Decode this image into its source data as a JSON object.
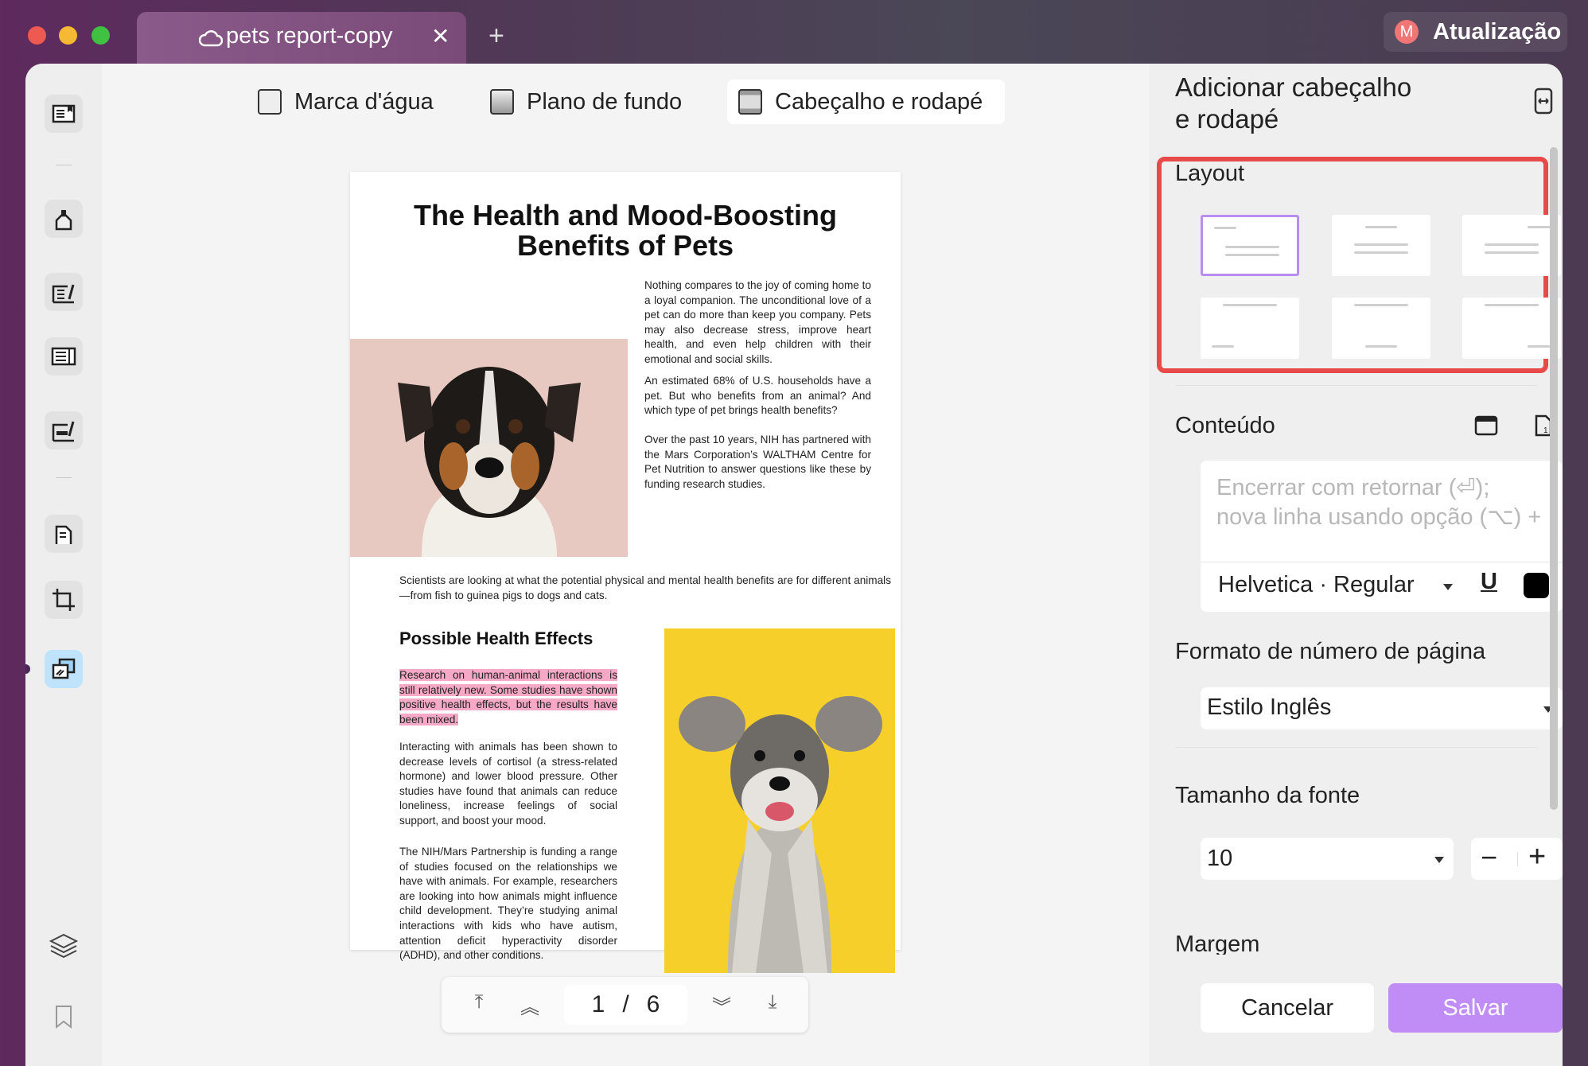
{
  "titlebar": {
    "tab_title": "pets report-copy",
    "update_label": "Atualização",
    "avatar_letter": "M"
  },
  "toolbar": {
    "watermark": "Marca d'água",
    "background": "Plano de fundo",
    "header_footer": "Cabeçalho e rodapé"
  },
  "document": {
    "title_line1": "The Health and Mood-Boosting",
    "title_line2": "Benefits of Pets",
    "p1": "Nothing compares to the joy of coming home to a loyal companion. The unconditional love of a pet can do more than keep you company. Pets may also decrease stress, improve heart health, and even help children with their emotional and social skills.",
    "p2": "An estimated 68% of U.S. households have a pet. But who benefits from an animal? And which type of pet brings health benefits?",
    "p3": "Over the past 10 years, NIH has partnered with the Mars Corporation’s WALTHAM Centre for Pet Nutrition to answer questions like these by funding research studies.",
    "p4": "Scientists are looking at what the potential physical and mental health benefits are for different animals—from fish to guinea pigs to dogs and cats.",
    "heading": "Possible Health Effects",
    "p5_highlighted": "Research on human-animal interactions is still relatively new. Some studies have shown positive health effects, but the results have been mixed.",
    "p6": "Interacting with animals has been shown to decrease levels of cortisol (a stress-related hormone) and lower blood pressure. Other studies have found that animals can reduce loneliness, increase feelings of social support, and boost your mood.",
    "p7": "The NIH/Mars Partnership is funding a range of studies focused on the relationships we have with animals. For example, researchers are looking into how animals might influence child development. They’re studying animal interactions with kids who have autism, attention deficit hyperactivity disorder (ADHD), and other conditions."
  },
  "pagenav": {
    "current": "1",
    "separator": "/",
    "total": "6"
  },
  "panel": {
    "title_line1": "Adicionar cabeçalho",
    "title_line2": "e rodapé",
    "layout_label": "Layout",
    "layout_selected": 1,
    "content_label": "Conteúdo",
    "content_placeholder_line1": "Encerrar com retornar (⏎);",
    "content_placeholder_line2": "nova linha usando opção (⌥) +",
    "font": "Helvetica · Regular",
    "underline": "U",
    "text_color": "#000000",
    "page_format_label": "Formato de número de página",
    "page_format_value": "Estilo Inglês",
    "font_size_label": "Tamanho da fonte",
    "font_size_value": "10",
    "margin_label": "Margem",
    "cancel": "Cancelar",
    "save": "Salvar"
  },
  "colors": {
    "accent": "#c08cf6",
    "highlight_box": "#e84a4a",
    "text_highlight": "#f6a9c6"
  }
}
